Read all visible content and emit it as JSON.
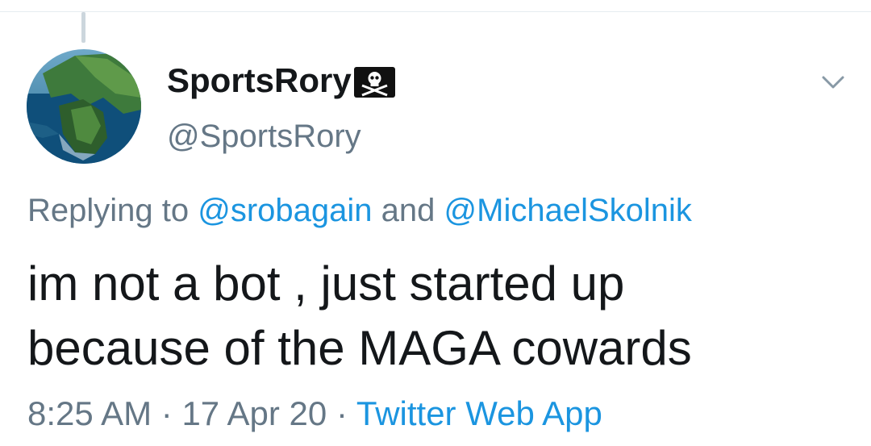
{
  "tweet": {
    "display_name": "SportsRory",
    "flag_icon": "pirate-flag-icon",
    "handle": "@SportsRory",
    "replying_prefix": "Replying to",
    "replying_mention_1": "@srobagain",
    "replying_and": "and",
    "replying_mention_2": "@MichaelSkolnik",
    "text": "im not a bot , just started up\nbecause of the MAGA cowards",
    "time": "8:25 AM",
    "sep1": "·",
    "date": "17 Apr 20",
    "sep2": "·",
    "source": "Twitter Web App",
    "menu_icon": "chevron-down-icon"
  },
  "colors": {
    "text": "#14171a",
    "secondary": "#657786",
    "link": "#1b95e0",
    "divider": "#e6ecf0",
    "thread_line": "#ccd6dd"
  }
}
